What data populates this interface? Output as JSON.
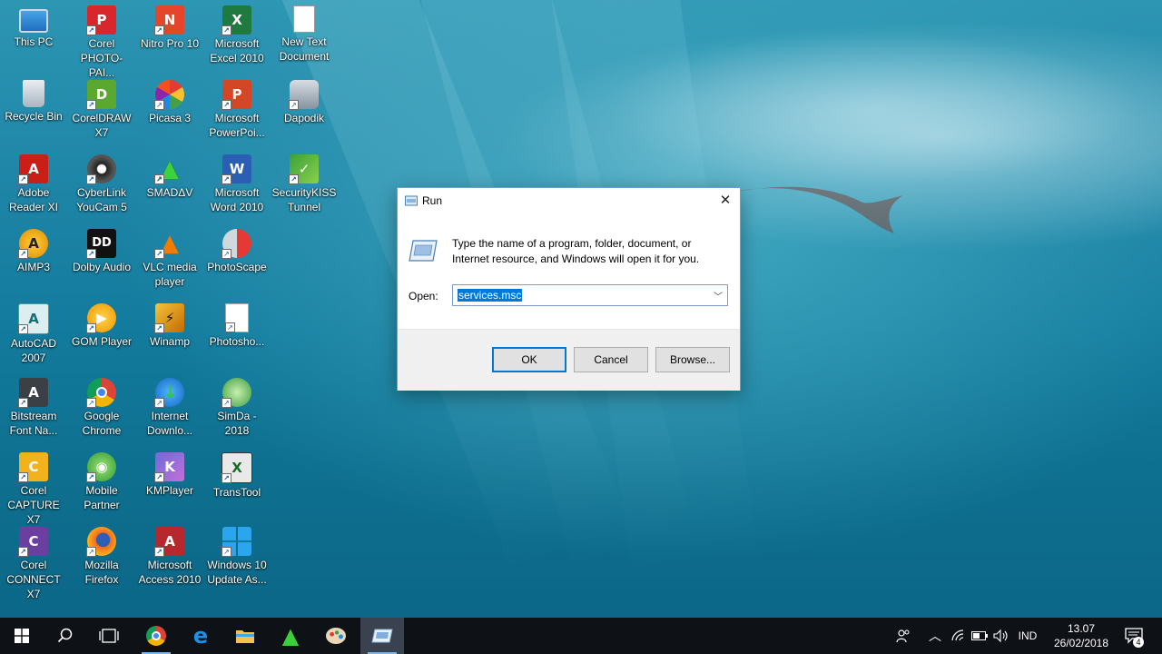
{
  "desktop": {
    "icons": [
      {
        "label": "This PC",
        "icon": "this-pc-icon"
      },
      {
        "label": "Corel\nPHOTO-PAI...",
        "icon": "corel-photo-paint-icon"
      },
      {
        "label": "Nitro Pro 10",
        "icon": "nitro-pro-icon"
      },
      {
        "label": "Microsoft\nExcel 2010",
        "icon": "excel-icon"
      },
      {
        "label": "New Text\nDocument",
        "icon": "text-document-icon"
      },
      {
        "label": "Recycle Bin",
        "icon": "recycle-bin-icon"
      },
      {
        "label": "CorelDRAW\nX7",
        "icon": "coreldraw-icon"
      },
      {
        "label": "Picasa 3",
        "icon": "picasa-icon"
      },
      {
        "label": "Microsoft\nPowerPoi...",
        "icon": "powerpoint-icon"
      },
      {
        "label": "Dapodik",
        "icon": "dapodik-icon"
      },
      {
        "label": "Adobe\nReader XI",
        "icon": "adobe-reader-icon"
      },
      {
        "label": "CyberLink\nYouCam 5",
        "icon": "youcam-icon"
      },
      {
        "label": "SMADΔV",
        "icon": "smadav-icon"
      },
      {
        "label": "Microsoft\nWord 2010",
        "icon": "word-icon"
      },
      {
        "label": "SecurityKISS\nTunnel",
        "icon": "securitykiss-icon"
      },
      {
        "label": "AIMP3",
        "icon": "aimp-icon"
      },
      {
        "label": "Dolby Audio",
        "icon": "dolby-icon"
      },
      {
        "label": "VLC media\nplayer",
        "icon": "vlc-icon"
      },
      {
        "label": "PhotoScape",
        "icon": "photoscape-icon"
      },
      {
        "label": "AutoCAD\n2007",
        "icon": "autocad-icon"
      },
      {
        "label": "GOM Player",
        "icon": "gom-player-icon"
      },
      {
        "label": "Winamp",
        "icon": "winamp-icon"
      },
      {
        "label": "Photosho...",
        "icon": "photoshop-file-icon"
      },
      {
        "label": "Bitstream\nFont Na...",
        "icon": "bitstream-icon"
      },
      {
        "label": "Google\nChrome",
        "icon": "chrome-icon"
      },
      {
        "label": "Internet\nDownlo...",
        "icon": "idm-icon"
      },
      {
        "label": "SimDa -\n2018",
        "icon": "simda-icon"
      },
      {
        "label": "Corel\nCAPTURE X7",
        "icon": "corel-capture-icon"
      },
      {
        "label": "Mobile\nPartner",
        "icon": "mobile-partner-icon"
      },
      {
        "label": "KMPlayer",
        "icon": "kmplayer-icon"
      },
      {
        "label": "TransTool",
        "icon": "transtool-icon"
      },
      {
        "label": "Corel\nCONNECT X7",
        "icon": "corel-connect-icon"
      },
      {
        "label": "Mozilla\nFirefox",
        "icon": "firefox-icon"
      },
      {
        "label": "Microsoft\nAccess 2010",
        "icon": "access-icon"
      },
      {
        "label": "Windows 10\nUpdate As...",
        "icon": "windows-update-icon"
      }
    ]
  },
  "run_dialog": {
    "title": "Run",
    "description": "Type the name of a program, folder, document, or Internet resource, and Windows will open it for you.",
    "open_label": "Open:",
    "open_value": "services.msc",
    "ok": "OK",
    "cancel": "Cancel",
    "browse": "Browse..."
  },
  "taskbar": {
    "apps": [
      "start-icon",
      "search-icon",
      "task-view-icon",
      "chrome-icon",
      "edge-icon",
      "file-explorer-icon",
      "smadav-icon",
      "paint-icon",
      "run-icon"
    ],
    "language": "IND",
    "time": "13.07",
    "date": "26/02/2018",
    "notification_count": "4"
  },
  "colors": {
    "accent": "#0078d7",
    "taskbar": "#0e1116",
    "desktop_water": "#1f86a8"
  }
}
